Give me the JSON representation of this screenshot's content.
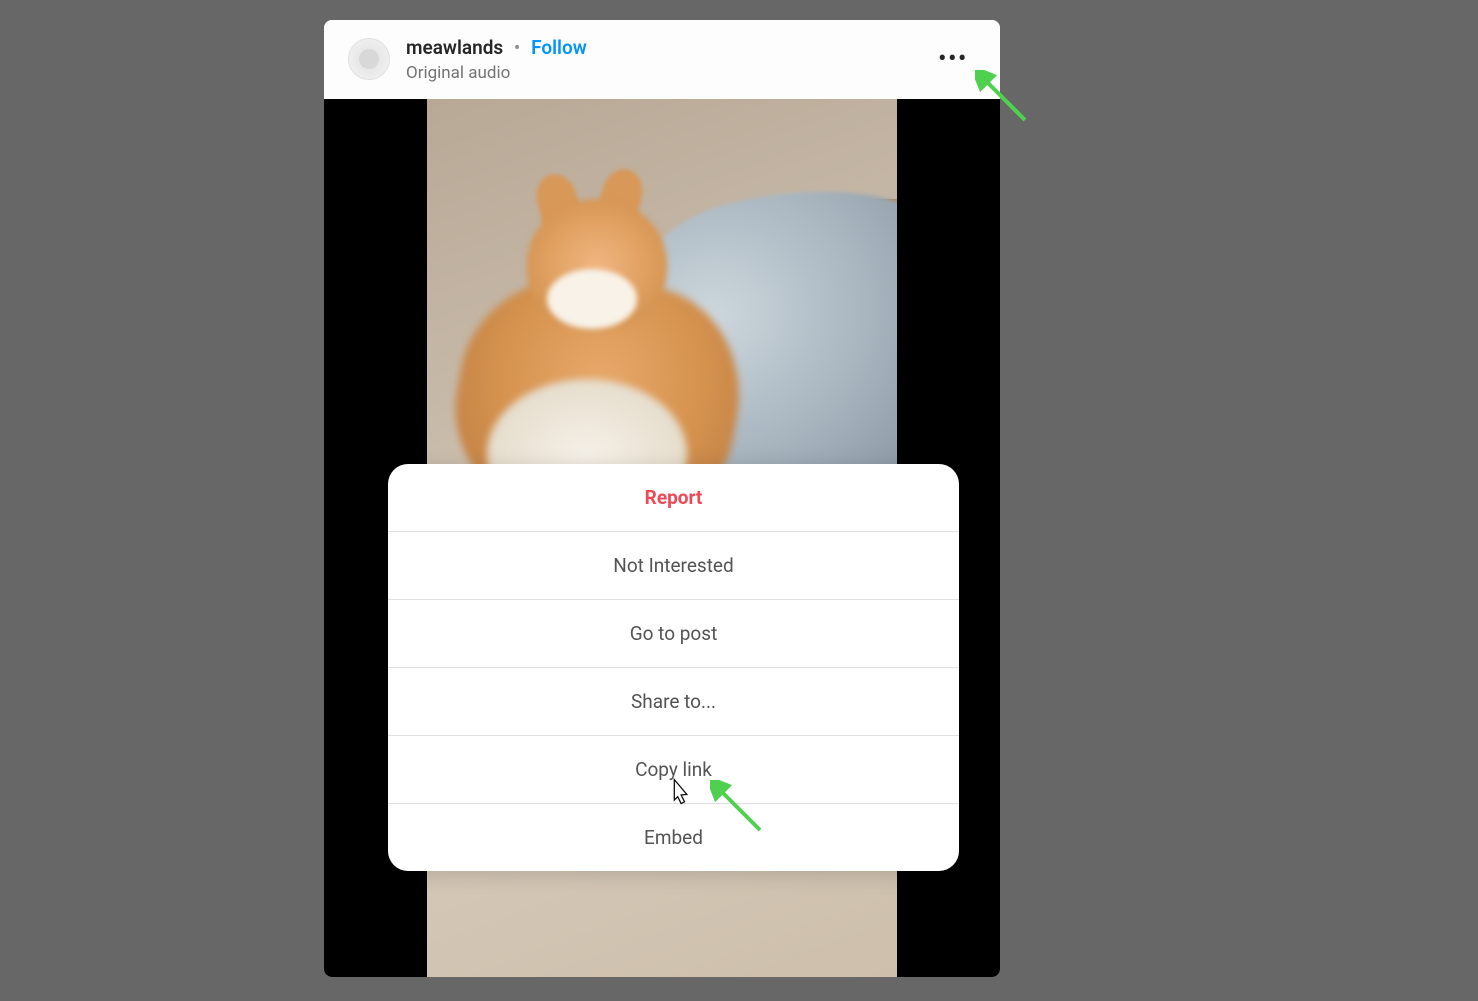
{
  "post": {
    "username": "meawlands",
    "separator": "•",
    "follow_label": "Follow",
    "audio_label": "Original audio",
    "more_glyph": "•••",
    "video_description": "Orange and white cat burrowing into a grey blanket"
  },
  "menu": {
    "items": [
      {
        "label": "Report",
        "danger": true
      },
      {
        "label": "Not Interested",
        "danger": false
      },
      {
        "label": "Go to post",
        "danger": false
      },
      {
        "label": "Share to...",
        "danger": false
      },
      {
        "label": "Copy link",
        "danger": false
      },
      {
        "label": "Embed",
        "danger": false
      }
    ]
  },
  "colors": {
    "danger": "#ed4956",
    "link": "#0095f6",
    "annotation": "#4fd14f"
  }
}
